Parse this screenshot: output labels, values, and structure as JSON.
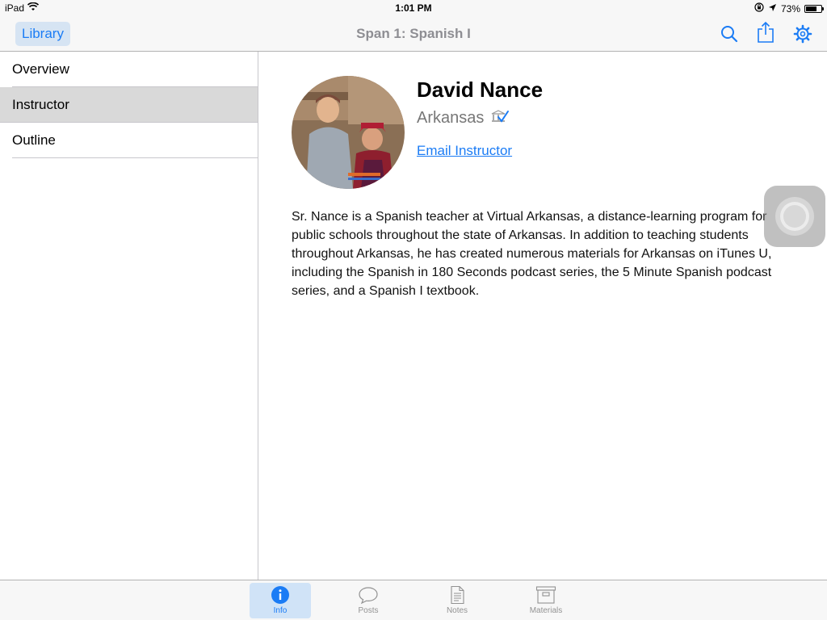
{
  "status_bar": {
    "device": "iPad",
    "time": "1:01 PM",
    "battery": "73%",
    "battery_level": 0.73
  },
  "nav": {
    "back_label": "Library",
    "title": "Span 1: Spanish I",
    "icons": [
      "search-icon",
      "share-icon",
      "settings-gear-icon"
    ]
  },
  "sidebar": {
    "items": [
      {
        "label": "Overview",
        "selected": false
      },
      {
        "label": "Instructor",
        "selected": true
      },
      {
        "label": "Outline",
        "selected": false
      }
    ]
  },
  "instructor": {
    "name": "David Nance",
    "location": "Arkansas",
    "email_label": "Email Instructor",
    "bio": "Sr. Nance is a Spanish teacher at Virtual Arkansas, a distance-learning program for public schools throughout the state of Arkansas. In addition to teaching students throughout Arkansas, he has created numerous materials for Arkansas on iTunes U, including the Spanish in 180 Seconds podcast series, the 5 Minute Spanish podcast series, and a Spanish I textbook."
  },
  "tabs": [
    {
      "label": "Info",
      "icon": "info-icon",
      "active": true
    },
    {
      "label": "Posts",
      "icon": "speech-bubble-icon",
      "active": false
    },
    {
      "label": "Notes",
      "icon": "note-page-icon",
      "active": false
    },
    {
      "label": "Materials",
      "icon": "materials-box-icon",
      "active": false
    }
  ],
  "colors": {
    "accent": "#1b7cf5",
    "selected_row": "#d9d9d9",
    "bar_background": "#f7f7f7"
  }
}
